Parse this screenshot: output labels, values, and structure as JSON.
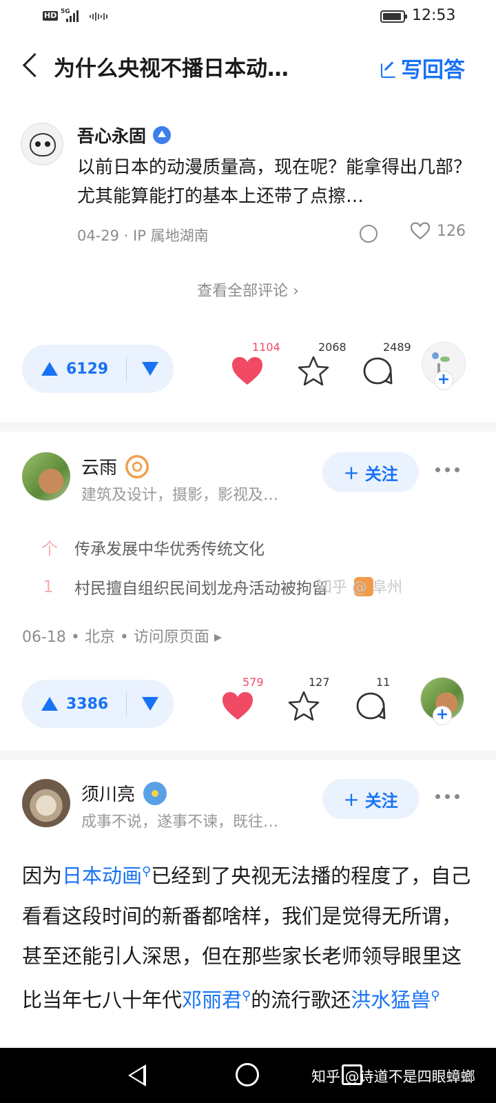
{
  "status_bar": {
    "hd": "HD",
    "network": "5G",
    "time": "12:53"
  },
  "nav": {
    "title": "为什么央视不播日本动…",
    "write_label": "写回答"
  },
  "comment": {
    "name": "吾心永固",
    "text": "以前日本的动漫质量高，现在呢？能拿得出几部？尤其能算能打的基本上还带了点擦…",
    "meta": "04-29 · IP 属地湖南",
    "likes": "126",
    "view_all": "查看全部评论 ›"
  },
  "answer1_actions": {
    "upvotes": "6129",
    "hearts": "1104",
    "favorites": "2068",
    "comments": "2489"
  },
  "answer2": {
    "name": "云雨",
    "bio": "建筑及设计，摄影，影视及…",
    "follow_label": "关注",
    "hot": [
      {
        "rank": "个",
        "text": "传承发展中华优秀传统文化"
      },
      {
        "rank": "1",
        "text": "村民擅自组织民间划龙舟活动被拘留"
      }
    ],
    "watermark": "知乎 @ 阜州",
    "date_line": "06-18 • 北京 • 访问原页面 ▸",
    "actions": {
      "upvotes": "3386",
      "hearts": "579",
      "favorites": "127",
      "comments": "11"
    }
  },
  "answer3": {
    "name": "须川亮",
    "bio": "成事不说，遂事不谏，既往…",
    "follow_label": "关注",
    "body": {
      "p1": "因为",
      "kw1": "日本动画",
      "p2": "已经到了央视无法播的程度了，自己看看这段时间的新番都啥样，我们是觉得无所谓，甚至还能引人深思，但在那些家长老师领导眼里这比当年七八十年代",
      "kw2": "邓丽君",
      "p3": "的流行歌还",
      "kw3": "洪水猛兽"
    }
  },
  "bottom_watermark": "知乎 @诗道不是四眼蟑螂",
  "colors": {
    "accent": "#1772f6",
    "heart": "#f04a64",
    "vote_bg": "#eaf2fe"
  },
  "icons": [
    "back-icon",
    "write-icon",
    "reply-icon",
    "heart-icon",
    "star-icon",
    "comment-icon",
    "more-icon"
  ]
}
